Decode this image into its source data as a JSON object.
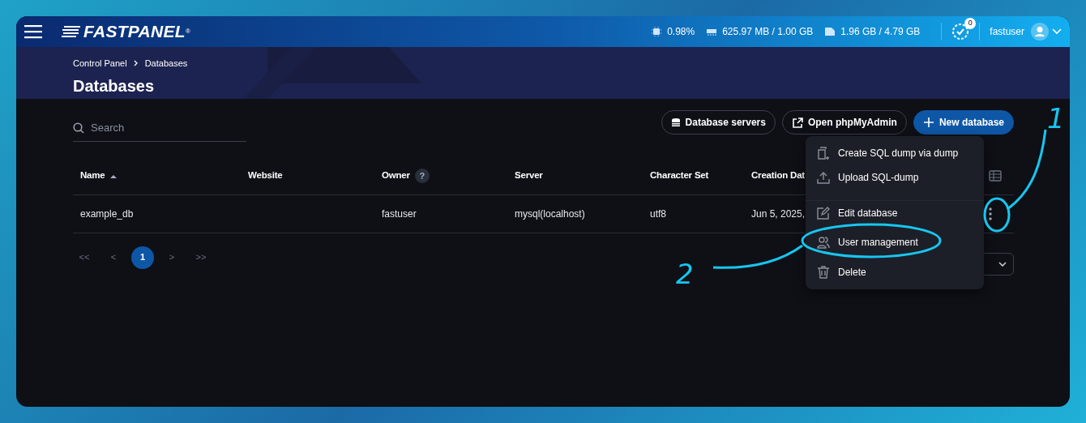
{
  "header": {
    "logo": "FASTPANEL",
    "logo_mark": "®",
    "stats": [
      {
        "kind": "cpu",
        "value": "0.98%"
      },
      {
        "kind": "ram",
        "value": "625.97 MB / 1.00 GB"
      },
      {
        "kind": "disk",
        "value": "1.96 GB / 4.79 GB"
      }
    ],
    "tasks_badge": "0",
    "user": "fastuser"
  },
  "breadcrumb": [
    "Control Panel",
    "Databases"
  ],
  "page_title": "Databases",
  "search": {
    "placeholder": "Search"
  },
  "actions": [
    {
      "label": "Database servers",
      "kind": "servers"
    },
    {
      "label": "Open phpMyAdmin",
      "kind": "external"
    },
    {
      "label": "New database",
      "kind": "new"
    }
  ],
  "table": {
    "columns": [
      {
        "label": "Name",
        "sorted": true
      },
      {
        "label": "Website",
        "sorted": false
      },
      {
        "label": "Owner",
        "sorted": false,
        "help_label": "?"
      },
      {
        "label": "Server",
        "sorted": false
      },
      {
        "label": "Character Set",
        "sorted": false
      },
      {
        "label": "Creation Dat",
        "sorted": false
      }
    ],
    "rows": [
      {
        "name": "example_db",
        "owner": "fastuser",
        "server": "mysql(localhost)",
        "charset": "utf8",
        "created": "Jun 5, 2025,"
      }
    ]
  },
  "pagination": [
    {
      "label": "<<",
      "selected": false
    },
    {
      "label": "<",
      "selected": false
    },
    {
      "label": "1",
      "selected": true
    },
    {
      "label": ">",
      "selected": false
    },
    {
      "label": ">>",
      "selected": false
    }
  ],
  "row_menu": [
    {
      "label": "Create SQL dump via dump",
      "kind": "dump",
      "separated": false
    },
    {
      "label": "Upload SQL-dump",
      "kind": "upload",
      "separated": false
    },
    {
      "label": "Edit database",
      "kind": "edit",
      "separated": true
    },
    {
      "label": "User management",
      "kind": "users",
      "separated": false
    },
    {
      "label": "Delete",
      "kind": "delete",
      "separated": false
    }
  ],
  "annotations": [
    {
      "label": "1"
    },
    {
      "label": "2"
    }
  ]
}
